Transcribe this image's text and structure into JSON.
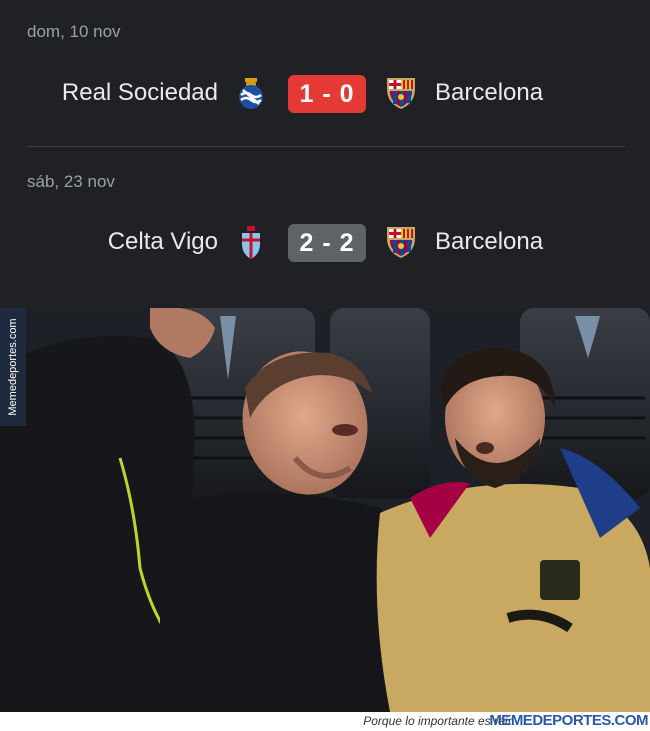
{
  "matches": [
    {
      "date": "dom, 10 nov",
      "home": "Real Sociedad",
      "home_crest_icon": "real-sociedad-crest-icon",
      "score": "1 - 0",
      "score_color": "#e53935",
      "away": "Barcelona",
      "away_crest_icon": "barcelona-crest-icon"
    },
    {
      "date": "sáb, 23 nov",
      "home": "Celta Vigo",
      "home_crest_icon": "celta-vigo-crest-icon",
      "score": "2 - 2",
      "score_color": "#5f6368",
      "away": "Barcelona",
      "away_crest_icon": "barcelona-crest-icon"
    }
  ],
  "watermark": {
    "side_text": "Memedeportes.com",
    "tagline": "Porque lo importante es reír",
    "brand": "MEMEDEPORTES.COM"
  },
  "colors": {
    "panel_bg": "#202124",
    "text": "#e8eaed",
    "muted": "#9aa0a6",
    "loss_red": "#e53935",
    "draw_gray": "#5f6368",
    "barca_gold": "#c9a961"
  }
}
